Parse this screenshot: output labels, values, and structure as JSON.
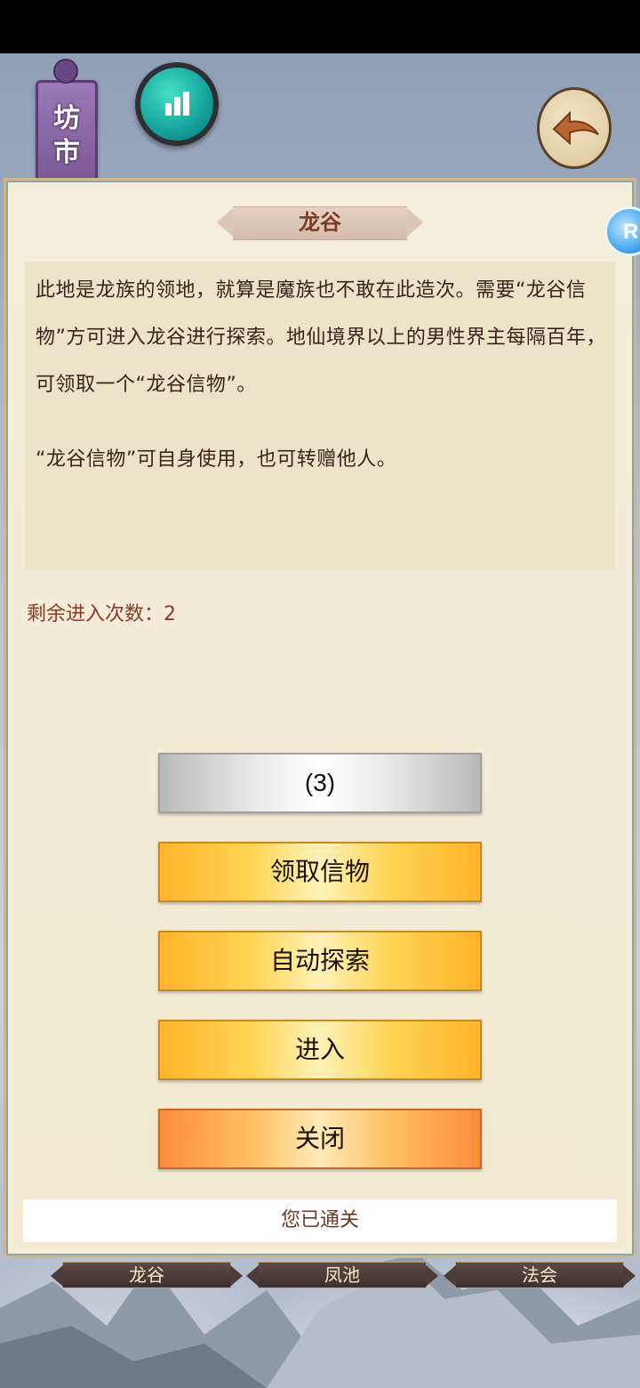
{
  "hud": {
    "banner_label_top": "坊",
    "banner_label_bottom": "市",
    "stats_icon": "bar-chart-icon",
    "back_icon": "back-arrow-icon",
    "side_bot_letter": "R"
  },
  "dialog": {
    "title": "龙谷",
    "description_p1": "此地是龙族的领地，就算是魔族也不敢在此造次。需要“龙谷信物”方可进入龙谷进行探索。地仙境界以上的男性界主每隔百年，可领取一个“龙谷信物”。",
    "description_p2": "“龙谷信物”可自身使用，也可转赠他人。",
    "remaining_entries": "剩余进入次数：2",
    "buttons": {
      "countdown": "(3)",
      "claim": "领取信物",
      "auto_explore": "自动探索",
      "enter": "进入",
      "close": "关闭"
    },
    "footer_message": "您已通关"
  },
  "bottom_tabs": [
    {
      "label": "龙谷"
    },
    {
      "label": "凤池"
    },
    {
      "label": "法会"
    }
  ],
  "colors": {
    "panel_bg": "#f4ecd6",
    "title_text": "#7a3b2b",
    "gold_button": "#ffd453",
    "orange_button": "#ff8d3a"
  }
}
